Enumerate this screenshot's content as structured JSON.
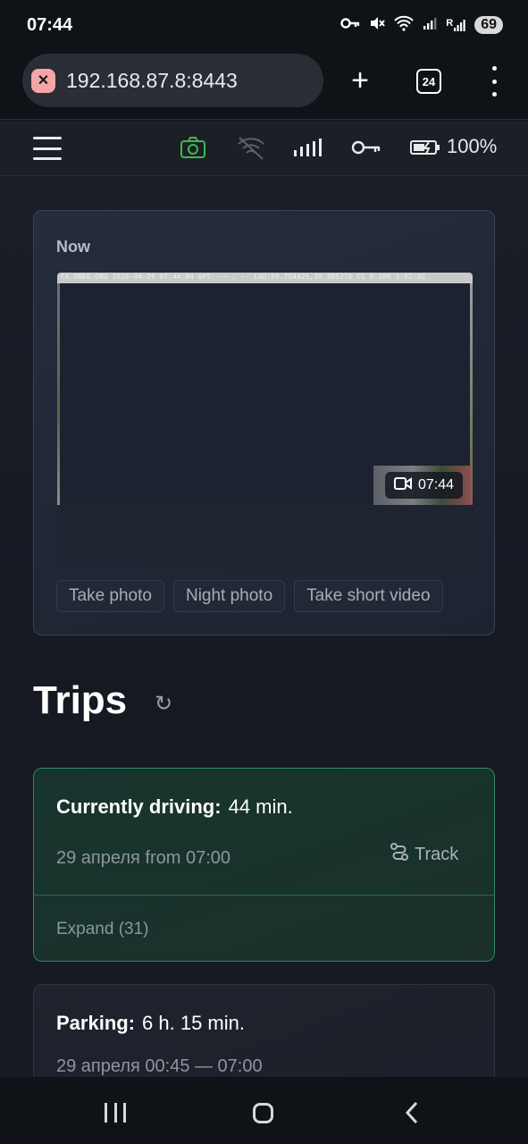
{
  "status_bar": {
    "time": "07:44",
    "signal_label": "R",
    "battery_level": "69"
  },
  "browser": {
    "url": "192.168.87.8:8443",
    "tab_count": "24",
    "security_state": "not-secure"
  },
  "app_header": {
    "icons": [
      "menu-icon",
      "camera-icon",
      "wifi-off-icon",
      "signal-bars-icon",
      "key-icon",
      "battery-charging-icon"
    ],
    "camera_color": "#3fb950",
    "battery_percent": "100%"
  },
  "now_card": {
    "title": "Now",
    "photo_stamp": "CX.DREG.ORG 2026-04-29 07:44:04 GPS: -- , -- LGS:59.754425,30.385276 C1 B:100 1:02:32",
    "video_time": "07:44",
    "buttons": [
      "Take photo",
      "Night photo",
      "Take short video"
    ]
  },
  "trips": {
    "title": "Trips",
    "refresh_glyph": "↻",
    "current": {
      "label": "Currently driving:",
      "duration": "44 min.",
      "subtitle": "29 апреля from 07:00",
      "track_label": "Track",
      "expand_label": "Expand (31)",
      "accent_color": "#2f8a63"
    },
    "parking": {
      "label": "Parking:",
      "duration": "6 h. 15 min.",
      "subtitle": "29 апреля 00:45 — 07:00"
    }
  }
}
